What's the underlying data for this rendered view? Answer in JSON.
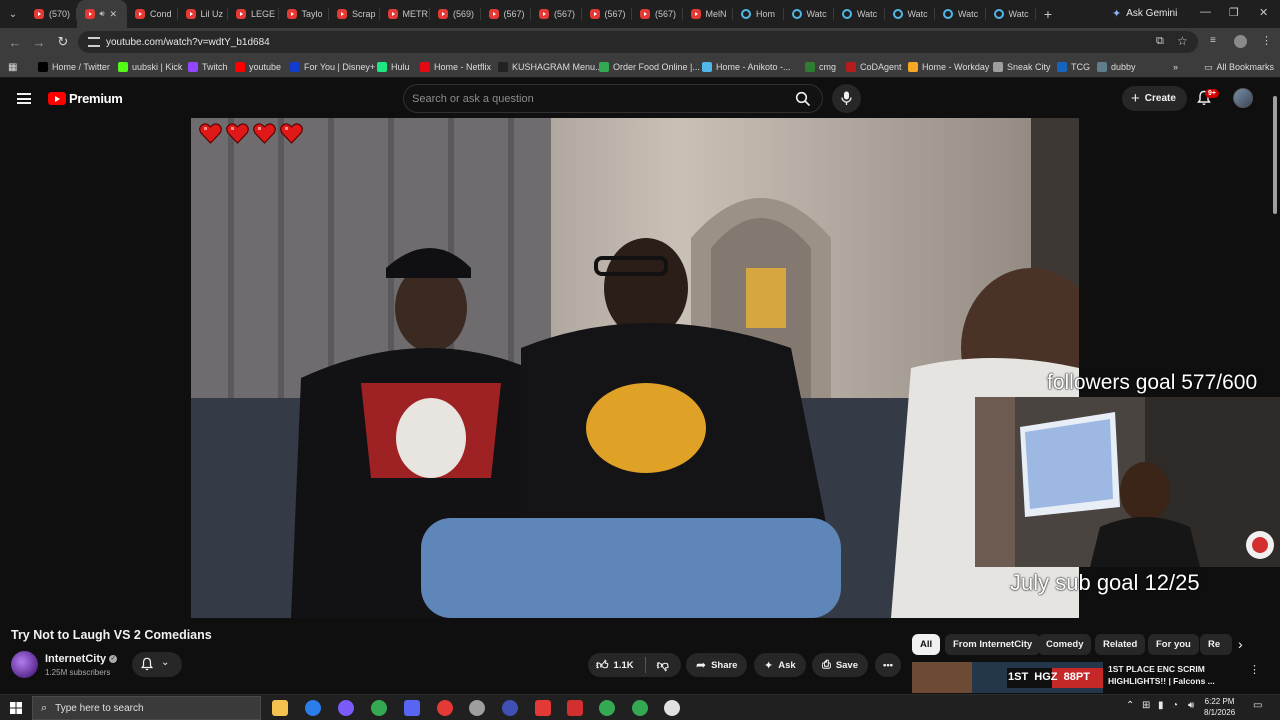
{
  "tabs": [
    {
      "label": "(570)",
      "icon": "youtube-icon"
    },
    {
      "label": "",
      "icon": "youtube-icon",
      "audio": true,
      "active": true
    },
    {
      "label": "Cond",
      "icon": "youtube-icon"
    },
    {
      "label": "Lil Uz",
      "icon": "youtube-icon"
    },
    {
      "label": "LEGE",
      "icon": "youtube-icon"
    },
    {
      "label": "Taylo",
      "icon": "youtube-icon"
    },
    {
      "label": "Scrap",
      "icon": "youtube-icon"
    },
    {
      "label": "METR",
      "icon": "youtube-icon"
    },
    {
      "label": "(569)",
      "icon": "youtube-icon"
    },
    {
      "label": "(567)",
      "icon": "youtube-icon"
    },
    {
      "label": "(567)",
      "icon": "youtube-icon"
    },
    {
      "label": "(567)",
      "icon": "youtube-icon"
    },
    {
      "label": "(567)",
      "icon": "youtube-icon"
    },
    {
      "label": "MelN",
      "icon": "youtube-icon"
    },
    {
      "label": "Hom",
      "icon": "anikoto-icon"
    },
    {
      "label": "Watc",
      "icon": "anikoto-icon"
    },
    {
      "label": "Watc",
      "icon": "anikoto-icon"
    },
    {
      "label": "Watc",
      "icon": "anikoto-icon"
    },
    {
      "label": "Watc",
      "icon": "anikoto-icon"
    },
    {
      "label": "Watc",
      "icon": "anikoto-icon"
    }
  ],
  "gemini_label": "Ask Gemini",
  "url": "youtube.com/watch?v=wdtY_b1d684",
  "bookmarks": [
    {
      "label": "Home / Twitter",
      "color": "#000000"
    },
    {
      "label": "uubski | Kick",
      "color": "#53fc18"
    },
    {
      "label": "Twitch",
      "color": "#9146ff"
    },
    {
      "label": "youtube",
      "color": "#ff0000"
    },
    {
      "label": "For You | Disney+",
      "color": "#113ccf"
    },
    {
      "label": "Hulu",
      "color": "#1ce783"
    },
    {
      "label": "Home - Netflix",
      "color": "#e50914"
    },
    {
      "label": "KUSHAGRAM Menu...",
      "color": "#222222"
    },
    {
      "label": "Order Food Online |...",
      "color": "#34a853"
    },
    {
      "label": "Home - Anikoto -...",
      "color": "#4fb8e8"
    },
    {
      "label": "cmg",
      "color": "#2e7d32"
    },
    {
      "label": "CoDAgent",
      "color": "#b71c1c"
    },
    {
      "label": "Home - Workday",
      "color": "#f5a623"
    },
    {
      "label": "Sneak City",
      "color": "#9e9e9e"
    },
    {
      "label": "TCG",
      "color": "#1565c0"
    },
    {
      "label": "dubby",
      "color": "#607d8b"
    }
  ],
  "all_bookmarks": "All Bookmarks",
  "youtube": {
    "brand": "Premium",
    "search_placeholder": "Search or ask a question",
    "create_label": "Create",
    "notif_count": "9+"
  },
  "overlay": {
    "followers_goal": "followers goal 577/600",
    "sub_goal": "July sub goal 12/25",
    "hearts": 4
  },
  "video": {
    "title": "Try Not to Laugh VS 2 Comedians",
    "channel": "InternetCity",
    "subscribers": "1.25M subscribers",
    "likes": "1.1K",
    "share": "Share",
    "ask": "Ask",
    "save": "Save"
  },
  "chips": [
    "All",
    "From InternetCity",
    "Comedy",
    "Related",
    "For you",
    "Re"
  ],
  "recommended": {
    "title": "1ST PLACE ENC SCRIM HIGHLIGHTS!! | Falcons ...",
    "thumb_text": "1ST  HGZ  88PT"
  },
  "taskbar": {
    "search_placeholder": "Type here to search",
    "time": "6:22 PM",
    "date": "8/1/2026"
  }
}
